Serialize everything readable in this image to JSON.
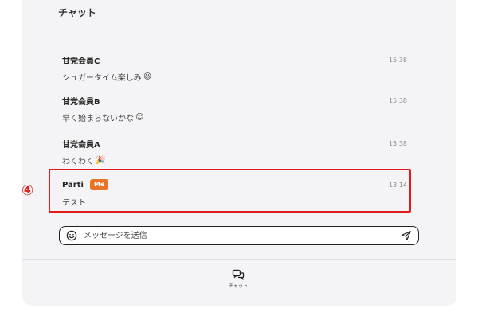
{
  "header": {
    "title": "チャット"
  },
  "messages": [
    {
      "sender": "甘党会員C",
      "time": "15:38",
      "text": "シュガータイム楽しみ",
      "emoji": "😆"
    },
    {
      "sender": "甘党会員B",
      "time": "15:38",
      "text": "早く始まらないかな",
      "emoji": "😊"
    },
    {
      "sender": "甘党会員A",
      "time": "15:38",
      "text": "わくわく",
      "emoji": "🎉"
    },
    {
      "sender": "Parti",
      "badge": "Me",
      "time": "13:14",
      "text": "テスト"
    }
  ],
  "annotation": {
    "marker": "④",
    "color": "#e31b1b"
  },
  "composer": {
    "placeholder": "メッセージを送信",
    "icon_left": "smile-icon",
    "icon_right": "send-icon"
  },
  "bottom_nav": {
    "items": [
      {
        "label": "チャット",
        "icon": "chat-bubbles-icon"
      }
    ]
  },
  "colors": {
    "accent": "#e8742a",
    "highlight": "#e31b1b",
    "panel": "#f4f4f6"
  }
}
